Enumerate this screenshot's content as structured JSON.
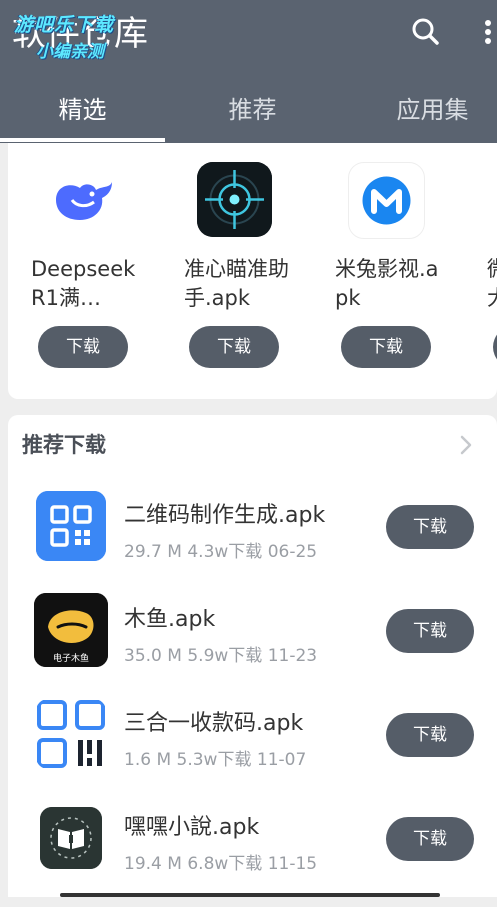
{
  "header": {
    "title": "软件仓库",
    "watermark_line1": "游吧乐下载",
    "watermark_line2": "小编亲测",
    "search_icon": "search-icon",
    "more_icon": "more-vertical-icon"
  },
  "tabs": [
    {
      "label": "精选",
      "active": true
    },
    {
      "label": "推荐",
      "active": false
    },
    {
      "label": "应用集",
      "active": false
    }
  ],
  "featured": [
    {
      "name": "Deepseek R1满…",
      "button": "下载",
      "icon": "whale-icon"
    },
    {
      "name": "准心瞄准助手.apk",
      "button": "下载",
      "icon": "crosshair-icon"
    },
    {
      "name": "米兔影视.apk",
      "button": "下载",
      "icon": "m-logo-icon"
    },
    {
      "name": "微大",
      "button": "",
      "icon": "partial-app-icon"
    }
  ],
  "recommend": {
    "title": "推荐下载",
    "arrow_icon": "chevron-right-icon",
    "items": [
      {
        "name": "二维码制作生成.apk",
        "size": "29.7 M",
        "downloads": "4.3w下载",
        "date": "06-25",
        "button": "下载",
        "icon": "qrcode-icon"
      },
      {
        "name": "木鱼.apk",
        "size": "35.0 M",
        "downloads": "5.9w下载",
        "date": "11-23",
        "button": "下载",
        "icon": "wooden-fish-icon",
        "icon_caption": "电子木鱼"
      },
      {
        "name": "三合一收款码.apk",
        "size": "1.6 M",
        "downloads": "5.3w下载",
        "date": "11-07",
        "button": "下载",
        "icon": "payment-code-icon"
      },
      {
        "name": "嘿嘿小說.apk",
        "size": "19.4 M",
        "downloads": "6.8w下载",
        "date": "11-15",
        "button": "下载",
        "icon": "book-icon"
      }
    ]
  },
  "colors": {
    "topbar": "#5a6370",
    "button": "#555d68",
    "accent_blue": "#3a87f5"
  }
}
